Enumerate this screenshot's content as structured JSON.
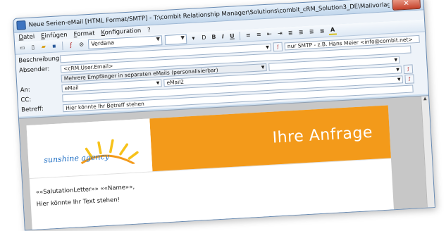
{
  "window": {
    "title": "Neue Serien-eMail [HTML Format/SMTP] - T:\\combit Relationship Manager\\Solutions\\combit_cRM_Solution3_DE\\Mailvorlagen\\Persone...",
    "close_label": "✕"
  },
  "menu": {
    "items": [
      {
        "label": "Datei",
        "key": "D"
      },
      {
        "label": "Einfügen",
        "key": "E"
      },
      {
        "label": "Format",
        "key": "F"
      },
      {
        "label": "Konfiguration",
        "key": "K"
      },
      {
        "label": "?",
        "key": ""
      }
    ]
  },
  "toolbar": {
    "font_name": "Verdana",
    "font_size": ""
  },
  "form": {
    "beschreibung_label": "Beschreibung:",
    "beschreibung_value": "",
    "smtp_hint": "nur SMTP - z.B. Hans Meier <info@combit.net>",
    "absender_label": "Absender:",
    "absender_value": "<cRM.User.Email>",
    "multi_recipient_value": "Mehrere Empfänger in separaten eMails (personalisierbar)",
    "an_label": "An:",
    "an_field1": "eMail",
    "an_field2": "eMail2",
    "cc_label": "CC:",
    "cc_value": "",
    "betreff_label": "Betreff:",
    "betreff_value": "Hier könnte Ihr Betreff stehen"
  },
  "document": {
    "logo_text": "sunshine agency",
    "headline": "Ihre Anfrage",
    "salutation": "««SalutationLetter»» ««Name»»,",
    "body_line": "Hier könnte Ihr Text stehen!"
  },
  "colors": {
    "banner_orange": "#f39a1a",
    "logo_blue": "#1f6fc4",
    "sun_yellow": "#f7c21a"
  }
}
